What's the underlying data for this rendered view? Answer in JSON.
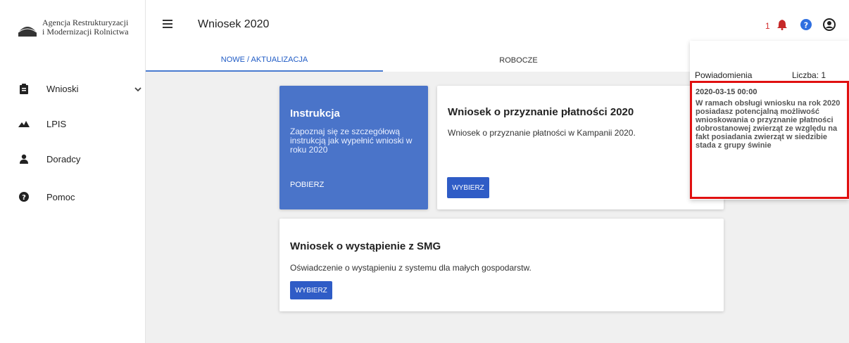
{
  "sidebar": {
    "logo_line1": "Agencja Restrukturyzacji",
    "logo_line2": "i Modernizacji Rolnictwa",
    "items": [
      {
        "label": "Wnioski",
        "icon": "clipboard-icon"
      },
      {
        "label": "LPIS",
        "icon": "mountains-icon"
      },
      {
        "label": "Doradcy",
        "icon": "person-icon"
      },
      {
        "label": "Pomoc",
        "icon": "help-circle-icon"
      }
    ]
  },
  "header": {
    "title": "Wniosek 2020",
    "notification_count": "1"
  },
  "tabs": [
    {
      "label": "NOWE / AKTUALIZACJA",
      "active": true
    },
    {
      "label": "ROBOCZE",
      "active": false
    }
  ],
  "cards": {
    "instruction": {
      "title": "Instrukcja",
      "description": "Zapoznaj się ze szczegółową instrukcją jak wypełnić wnioski w roku 2020",
      "link": "POBIERZ"
    },
    "payment": {
      "title": "Wniosek o przyznanie płatności 2020",
      "description": "Wniosek o przyznanie płatności w Kampanii 2020.",
      "button": "WYBIERZ"
    },
    "smg": {
      "title": "Wniosek o wystąpienie z SMG",
      "description": "Oświadczenie o wystąpieniu z systemu dla małych gospodarstw.",
      "button": "WYBIERZ"
    }
  },
  "notifications": {
    "header": "Powiadomienia",
    "count_label": "Liczba: 1",
    "items": [
      {
        "date": "2020-03-15 00:00",
        "text": "W ramach obsługi wniosku na rok 2020 posiadasz potencjalną możliwość wnioskowania o przyznanie płatności dobrostanowej zwierząt ze względu na fakt posiadania zwierząt w siedzibie stada z grupy świnie"
      }
    ]
  },
  "colors": {
    "primary": "#2f5cc6",
    "instruction_card": "#4a74c9",
    "notification_red": "#d32f2f",
    "highlight_border": "#e01010",
    "help_blue": "#2f6fe0"
  }
}
